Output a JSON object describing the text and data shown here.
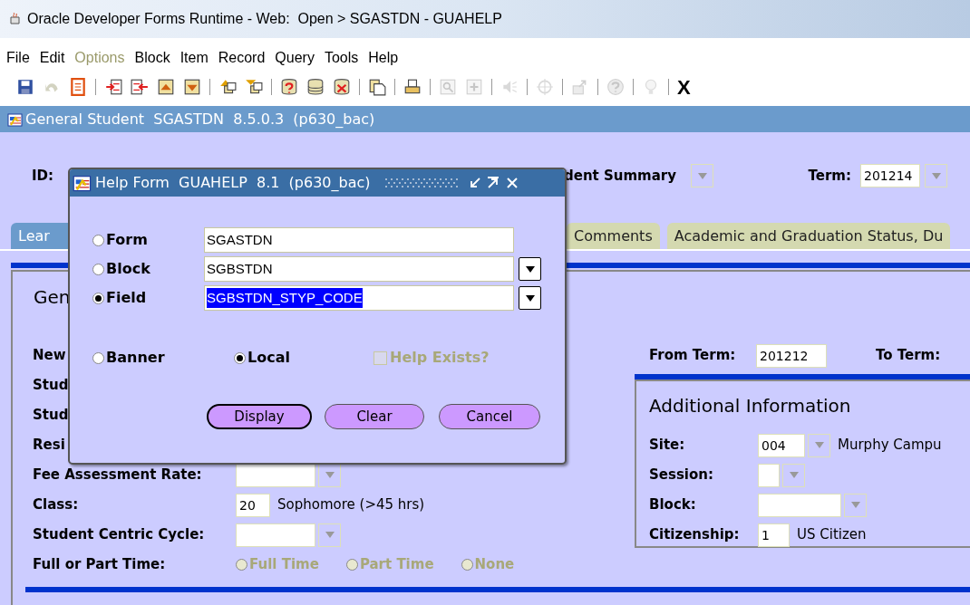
{
  "window": {
    "title": "Oracle Developer Forms Runtime - Web:  Open > SGASTDN - GUAHELP"
  },
  "menu": [
    {
      "label": "File",
      "disabled": false
    },
    {
      "label": "Edit",
      "disabled": false
    },
    {
      "label": "Options",
      "disabled": true
    },
    {
      "label": "Block",
      "disabled": false
    },
    {
      "label": "Item",
      "disabled": false
    },
    {
      "label": "Record",
      "disabled": false
    },
    {
      "label": "Query",
      "disabled": false
    },
    {
      "label": "Tools",
      "disabled": false
    },
    {
      "label": "Help",
      "disabled": false
    }
  ],
  "toolbar": [
    {
      "kind": "save",
      "disabled": false
    },
    {
      "kind": "undo",
      "disabled": true
    },
    {
      "kind": "document",
      "disabled": false
    },
    {
      "kind": "separator"
    },
    {
      "kind": "insert",
      "disabled": false
    },
    {
      "kind": "remove",
      "disabled": false
    },
    {
      "kind": "up",
      "disabled": false
    },
    {
      "kind": "down",
      "disabled": false
    },
    {
      "kind": "separator"
    },
    {
      "kind": "stack",
      "disabled": false
    },
    {
      "kind": "filter",
      "disabled": false
    },
    {
      "kind": "separator"
    },
    {
      "kind": "db-question",
      "disabled": false
    },
    {
      "kind": "database",
      "disabled": false
    },
    {
      "kind": "db-cancel",
      "disabled": false
    },
    {
      "kind": "separator"
    },
    {
      "kind": "copy",
      "disabled": false
    },
    {
      "kind": "separator"
    },
    {
      "kind": "print",
      "disabled": false
    },
    {
      "kind": "separator"
    },
    {
      "kind": "search",
      "disabled": true
    },
    {
      "kind": "plus",
      "disabled": true
    },
    {
      "kind": "separator"
    },
    {
      "kind": "speaker",
      "disabled": true
    },
    {
      "kind": "separator"
    },
    {
      "kind": "crosshair",
      "disabled": true
    },
    {
      "kind": "separator"
    },
    {
      "kind": "export",
      "disabled": true
    },
    {
      "kind": "separator"
    },
    {
      "kind": "help",
      "disabled": true
    },
    {
      "kind": "separator"
    },
    {
      "kind": "bulb",
      "disabled": true
    },
    {
      "kind": "separator"
    },
    {
      "kind": "text",
      "label": "X",
      "disabled": false
    }
  ],
  "form": {
    "title": "General Student  SGASTDN  8.5.0.3  (p630_bac)",
    "id_label": "ID:",
    "summary_label": "dent Summary",
    "term_label": "Term:",
    "term_value": "201214",
    "tabs": [
      {
        "label": "Lear",
        "selected": true
      },
      {
        "label": "Comments",
        "selected": false
      },
      {
        "label": "Academic and Graduation Status, Du",
        "selected": false
      }
    ],
    "heading": "Gen",
    "left_rows": [
      {
        "kind": "label",
        "label": "New"
      },
      {
        "kind": "label",
        "label": "Stud"
      },
      {
        "kind": "label",
        "label": "Stud"
      },
      {
        "kind": "label",
        "label": "Resi"
      },
      {
        "kind": "lov",
        "label": "Fee Assessment Rate:"
      },
      {
        "kind": "code",
        "label": "Class:",
        "value": "20",
        "description": "Sophomore (>45 hrs)"
      },
      {
        "kind": "lov",
        "label": "Student Centric Cycle:"
      },
      {
        "kind": "radios",
        "label": "Full or Part Time:",
        "options": [
          {
            "label": "Full Time",
            "selected": false,
            "disabled": true
          },
          {
            "label": "Part Time",
            "selected": false,
            "disabled": true
          },
          {
            "label": "None",
            "selected": false,
            "disabled": true
          }
        ]
      }
    ],
    "from_term_label": "From Term:",
    "from_term_value": "201212",
    "to_term_label": "To Term:",
    "additional": {
      "title": "Additional Information",
      "rows": [
        {
          "kind": "lov",
          "label": "Site:",
          "value": "004",
          "description": "Murphy Campu"
        },
        {
          "kind": "lov",
          "label": "Session:"
        },
        {
          "kind": "lov",
          "label": "Block:"
        },
        {
          "kind": "code",
          "label": "Citizenship:",
          "value": "1",
          "description": "US Citizen"
        }
      ]
    }
  },
  "dialog": {
    "title": "Help Form  GUAHELP  8.1  (p630_bac)",
    "scope": [
      {
        "label": "Form",
        "selected": false,
        "value": "SGASTDN",
        "highlighted": false,
        "has_list": false
      },
      {
        "label": "Block",
        "selected": false,
        "value": "SGBSTDN",
        "highlighted": false,
        "has_list": true
      },
      {
        "label": "Field",
        "selected": true,
        "value": "SGBSTDN_STYP_CODE",
        "highlighted": true,
        "has_list": true
      }
    ],
    "source": [
      {
        "label": "Banner",
        "selected": false
      },
      {
        "label": "Local",
        "selected": true
      }
    ],
    "help_exists": {
      "label": "Help Exists?",
      "checked": false,
      "disabled": true
    },
    "buttons": [
      {
        "label": "Display",
        "focused": true
      },
      {
        "label": "Clear",
        "focused": false
      },
      {
        "label": "Cancel",
        "focused": false
      }
    ]
  }
}
